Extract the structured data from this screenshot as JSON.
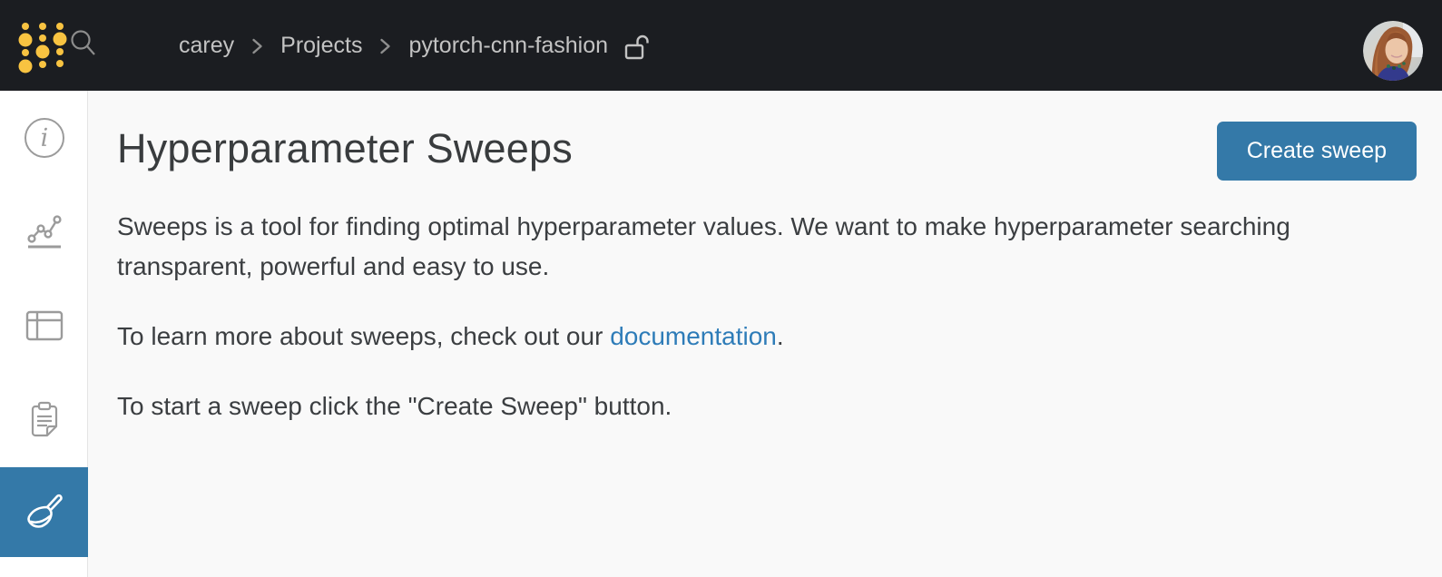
{
  "topbar": {
    "breadcrumb": {
      "entity": "carey",
      "section": "Projects",
      "project": "pytorch-cnn-fashion",
      "separator": ">"
    },
    "icons": [
      "wandb-logo-dots",
      "search-icon",
      "unlock-icon",
      "avatar-photo"
    ]
  },
  "sidebar": {
    "items": [
      {
        "name": "overview",
        "icon": "info-icon",
        "selected": false
      },
      {
        "name": "charts",
        "icon": "line-chart-icon",
        "selected": false
      },
      {
        "name": "table",
        "icon": "table-icon",
        "selected": false
      },
      {
        "name": "reports",
        "icon": "clipboard-icon",
        "selected": false
      },
      {
        "name": "sweeps",
        "icon": "broom-icon",
        "selected": true
      }
    ]
  },
  "main": {
    "title": "Hyperparameter Sweeps",
    "create_button_label": "Create sweep",
    "intro": "Sweeps is a tool for finding optimal hyperparameter values. We want to make hyperparameter searching transparent, powerful and easy to use.",
    "docs_prefix": "To learn more about sweeps, check out our ",
    "docs_link_label": "documentation",
    "docs_suffix": ".",
    "start_text": "To start a sweep click the \"Create Sweep\" button."
  },
  "colors": {
    "topbar_bg": "#1b1d21",
    "brand_gold": "#f8c341",
    "accent_blue": "#3479a8",
    "link_blue": "#2e7cb8",
    "text_dark": "#3b3e41",
    "content_bg": "#f9f9f9",
    "breadcrumb_text": "#c3c3c3",
    "sidebar_icon": "#9b9b9b"
  }
}
